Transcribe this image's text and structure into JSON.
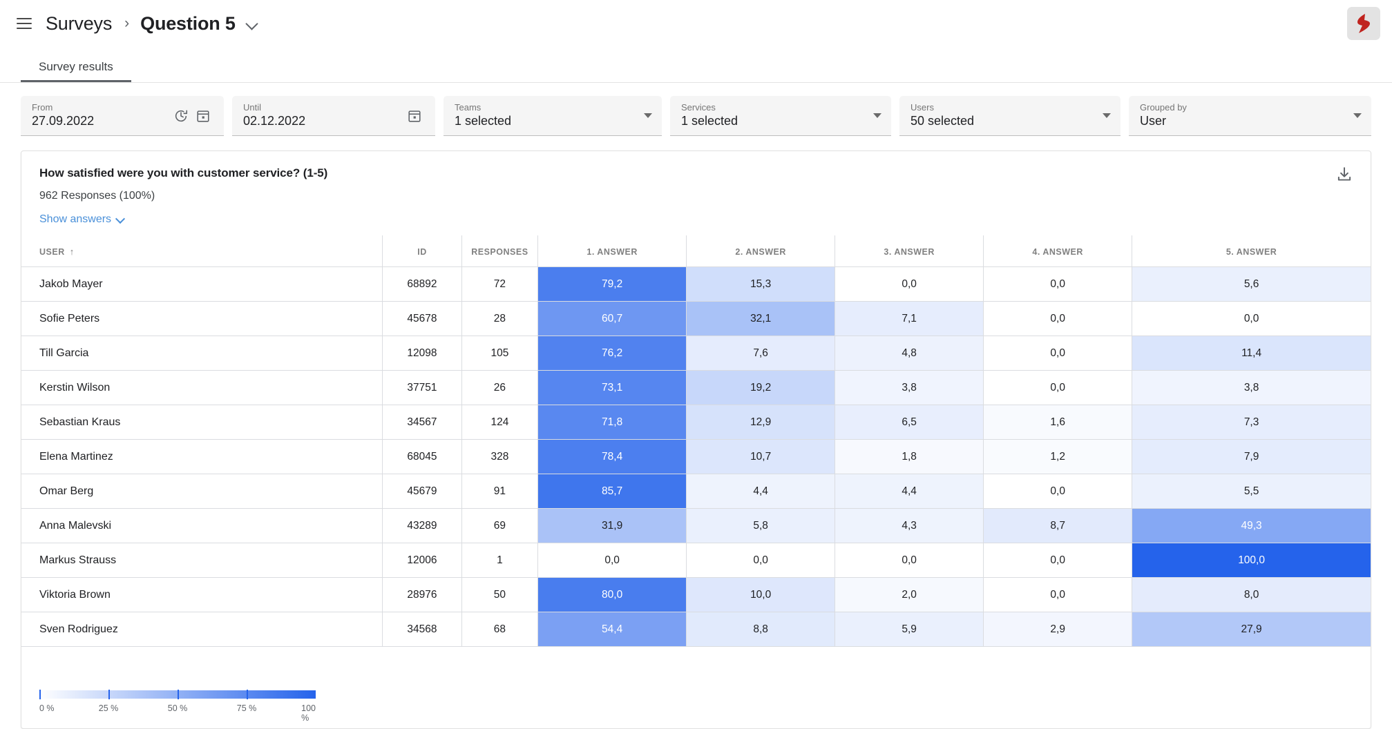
{
  "topbar": {
    "menu_icon": "hamburger-icon",
    "breadcrumb_root": "Surveys",
    "breadcrumb_separator": "›",
    "breadcrumb_current": "Question 5",
    "dropdown_icon": "chevron-down-icon",
    "logo_icon": "brand-logo-icon"
  },
  "tabs": [
    {
      "label": "Survey results",
      "active": true
    }
  ],
  "filters": [
    {
      "key": "from",
      "label": "From",
      "value": "27.09.2022",
      "icons": [
        "history-icon",
        "calendar-icon"
      ]
    },
    {
      "key": "until",
      "label": "Until",
      "value": "02.12.2022",
      "icons": [
        "calendar-icon"
      ]
    },
    {
      "key": "teams",
      "label": "Teams",
      "value": "1 selected",
      "icons": [
        "chevron-down-icon"
      ]
    },
    {
      "key": "services",
      "label": "Services",
      "value": "1 selected",
      "icons": [
        "chevron-down-icon"
      ]
    },
    {
      "key": "users",
      "label": "Users",
      "value": "50 selected",
      "icons": [
        "chevron-down-icon"
      ]
    },
    {
      "key": "groupedby",
      "label": "Grouped by",
      "value": "User",
      "icons": [
        "chevron-down-icon"
      ]
    }
  ],
  "card": {
    "question": "How satisfied were you with customer service? (1-5)",
    "responses_summary": "962 Responses (100%)",
    "show_answers": "Show answers",
    "download_icon": "download-icon"
  },
  "table": {
    "columns": [
      {
        "key": "user",
        "label": "USER",
        "sorted": true,
        "sort_icon": "↑"
      },
      {
        "key": "id",
        "label": "ID"
      },
      {
        "key": "responses",
        "label": "RESPONSES"
      },
      {
        "key": "a1",
        "label": "1. ANSWER"
      },
      {
        "key": "a2",
        "label": "2. ANSWER"
      },
      {
        "key": "a3",
        "label": "3. ANSWER"
      },
      {
        "key": "a4",
        "label": "4. ANSWER"
      },
      {
        "key": "a5",
        "label": "5. ANSWER"
      }
    ],
    "rows": [
      {
        "user": "Jakob Mayer",
        "id": "68892",
        "responses": "72",
        "answers": [
          "79,2",
          "15,3",
          "0,0",
          "0,0",
          "5,6"
        ]
      },
      {
        "user": "Sofie Peters",
        "id": "45678",
        "responses": "28",
        "answers": [
          "60,7",
          "32,1",
          "7,1",
          "0,0",
          "0,0"
        ]
      },
      {
        "user": "Till Garcia",
        "id": "12098",
        "responses": "105",
        "answers": [
          "76,2",
          "7,6",
          "4,8",
          "0,0",
          "11,4"
        ]
      },
      {
        "user": "Kerstin Wilson",
        "id": "37751",
        "responses": "26",
        "answers": [
          "73,1",
          "19,2",
          "3,8",
          "0,0",
          "3,8"
        ]
      },
      {
        "user": "Sebastian Kraus",
        "id": "34567",
        "responses": "124",
        "answers": [
          "71,8",
          "12,9",
          "6,5",
          "1,6",
          "7,3"
        ]
      },
      {
        "user": "Elena Martinez",
        "id": "68045",
        "responses": "328",
        "answers": [
          "78,4",
          "10,7",
          "1,8",
          "1,2",
          "7,9"
        ]
      },
      {
        "user": "Omar Berg",
        "id": "45679",
        "responses": "91",
        "answers": [
          "85,7",
          "4,4",
          "4,4",
          "0,0",
          "5,5"
        ]
      },
      {
        "user": "Anna Malevski",
        "id": "43289",
        "responses": "69",
        "answers": [
          "31,9",
          "5,8",
          "4,3",
          "8,7",
          "49,3"
        ]
      },
      {
        "user": "Markus Strauss",
        "id": "12006",
        "responses": "1",
        "answers": [
          "0,0",
          "0,0",
          "0,0",
          "0,0",
          "100,0"
        ]
      },
      {
        "user": "Viktoria Brown",
        "id": "28976",
        "responses": "50",
        "answers": [
          "80,0",
          "10,0",
          "2,0",
          "0,0",
          "8,0"
        ]
      },
      {
        "user": "Sven Rodriguez",
        "id": "34568",
        "responses": "68",
        "answers": [
          "54,4",
          "8,8",
          "5,9",
          "2,9",
          "27,9"
        ]
      }
    ]
  },
  "legend": {
    "ticks": [
      "0 %",
      "25 %",
      "50 %",
      "75 %",
      "100 %"
    ],
    "min_color": "#ffffff",
    "max_color": "#2563eb"
  },
  "chart_data": {
    "type": "heatmap",
    "title": "How satisfied were you with customer service? (1-5)",
    "subtitle": "962 Responses (100%)",
    "xlabel": "Answer",
    "ylabel": "User",
    "value_unit": "percent",
    "zlim": [
      0,
      100
    ],
    "colorscale": [
      "#ffffff",
      "#2563eb"
    ],
    "categories": [
      "1. ANSWER",
      "2. ANSWER",
      "3. ANSWER",
      "4. ANSWER",
      "5. ANSWER"
    ],
    "rows": [
      "Jakob Mayer",
      "Sofie Peters",
      "Till Garcia",
      "Kerstin Wilson",
      "Sebastian Kraus",
      "Elena Martinez",
      "Omar Berg",
      "Anna Malevski",
      "Markus Strauss",
      "Viktoria Brown",
      "Sven Rodriguez"
    ],
    "values": [
      [
        79.2,
        15.3,
        0.0,
        0.0,
        5.6
      ],
      [
        60.7,
        32.1,
        7.1,
        0.0,
        0.0
      ],
      [
        76.2,
        7.6,
        4.8,
        0.0,
        11.4
      ],
      [
        73.1,
        19.2,
        3.8,
        0.0,
        3.8
      ],
      [
        71.8,
        12.9,
        6.5,
        1.6,
        7.3
      ],
      [
        78.4,
        10.7,
        1.8,
        1.2,
        7.9
      ],
      [
        85.7,
        4.4,
        4.4,
        0.0,
        5.5
      ],
      [
        31.9,
        5.8,
        4.3,
        8.7,
        49.3
      ],
      [
        0.0,
        0.0,
        0.0,
        0.0,
        100.0
      ],
      [
        80.0,
        10.0,
        2.0,
        0.0,
        8.0
      ],
      [
        54.4,
        8.8,
        5.9,
        2.9,
        27.9
      ]
    ],
    "response_counts": [
      72,
      28,
      105,
      26,
      124,
      328,
      91,
      69,
      1,
      50,
      68
    ],
    "ids": [
      68892,
      45678,
      12098,
      37751,
      34567,
      68045,
      45679,
      43289,
      12006,
      28976,
      34568
    ],
    "legend_ticks": [
      0,
      25,
      50,
      75,
      100
    ],
    "legend_position": "bottom-left"
  }
}
